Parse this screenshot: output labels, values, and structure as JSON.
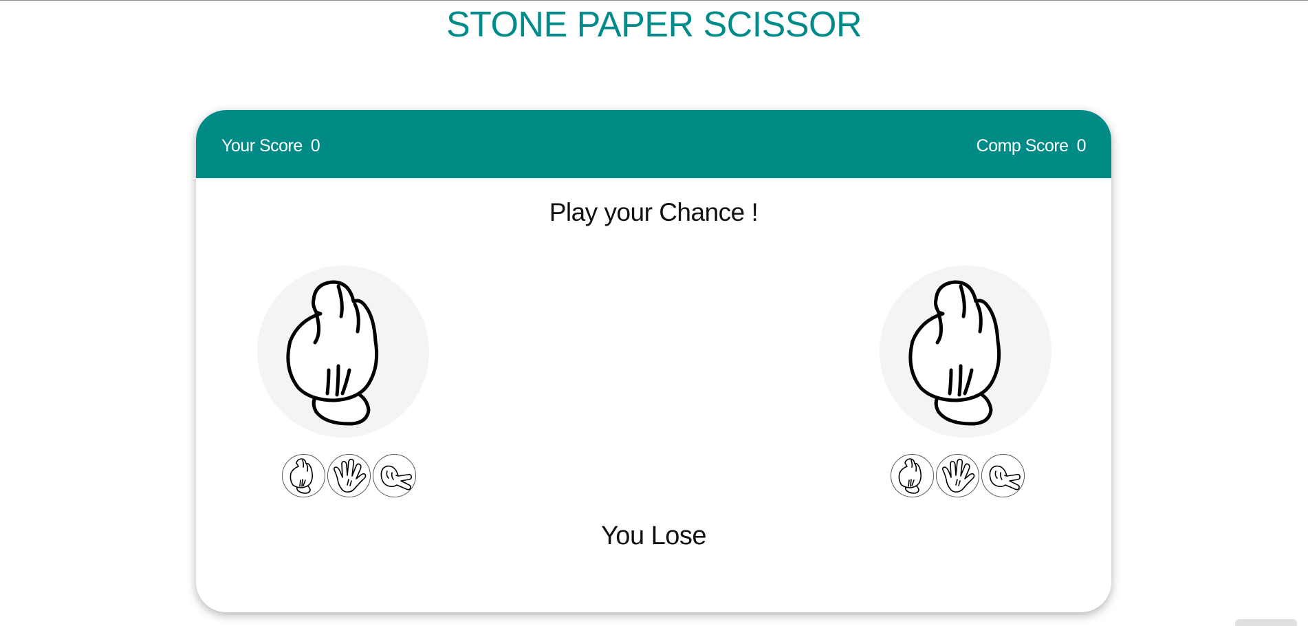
{
  "page": {
    "title": "STONE PAPER SCISSOR"
  },
  "scoreboard": {
    "your_label": "Your Score",
    "your_value": "0",
    "comp_label": "Comp Score",
    "comp_value": "0"
  },
  "game": {
    "prompt": "Play your Chance !",
    "result": "You Lose",
    "player_choice": "stone",
    "computer_choice": "stone"
  },
  "player_options": [
    "stone",
    "paper",
    "scissor"
  ],
  "computer_options": [
    "stone",
    "paper",
    "scissor"
  ],
  "colors": {
    "accent": "#008b87",
    "title": "#008b8b",
    "background": "#ffffff",
    "hand_circle": "#f4f4f4"
  },
  "icons": {
    "player_hand": "stone-hand-icon",
    "computer_hand": "stone-hand-icon",
    "options": [
      "stone-hand-icon",
      "paper-hand-icon",
      "scissor-hand-icon"
    ]
  }
}
